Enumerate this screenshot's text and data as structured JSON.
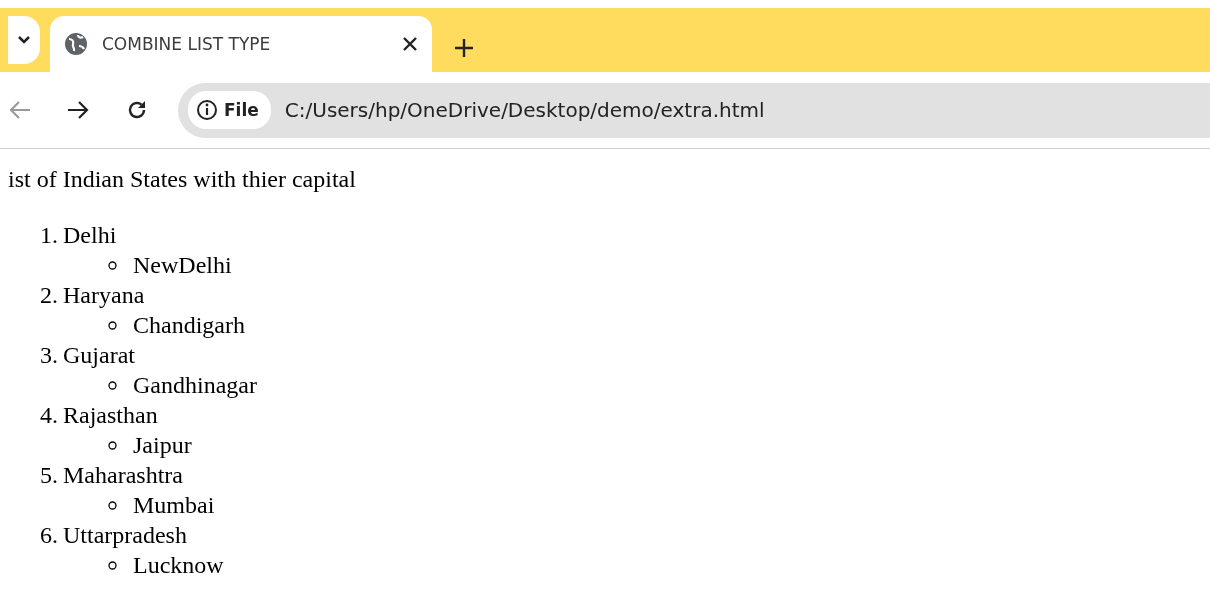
{
  "tab": {
    "title": "COMBINE LIST TYPE",
    "selected": true
  },
  "address": {
    "badge": "File",
    "url": "C:/Users/hp/OneDrive/Desktop/demo/extra.html"
  },
  "page": {
    "heading": "ist of Indian States with thier capital",
    "items": [
      {
        "number": "1.",
        "state": "Delhi",
        "children": [
          {
            "text": "NewDelhi"
          }
        ]
      },
      {
        "number": "2.",
        "state": "Haryana",
        "children": [
          {
            "text": "Chandigarh"
          }
        ]
      },
      {
        "number": "3.",
        "state": "Gujarat",
        "children": [
          {
            "text": "Gandhinagar"
          }
        ]
      },
      {
        "number": "4.",
        "state": "Rajasthan",
        "children": [
          {
            "text": "Jaipur"
          }
        ]
      },
      {
        "number": "5.",
        "state": "Maharashtra",
        "children": [
          {
            "text": "Mumbai"
          }
        ]
      },
      {
        "number": "6.",
        "state": "Uttarpradesh",
        "children": [
          {
            "text": "Lucknow"
          }
        ]
      }
    ]
  }
}
